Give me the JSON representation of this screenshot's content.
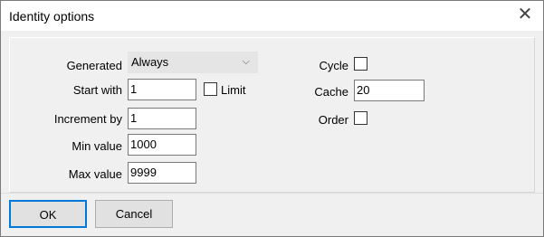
{
  "window": {
    "title": "Identity options"
  },
  "fields": {
    "generated": {
      "label": "Generated",
      "value": "Always"
    },
    "start_with": {
      "label": "Start with",
      "value": "1",
      "limit_label": "Limit"
    },
    "increment_by": {
      "label": "Increment by",
      "value": "1"
    },
    "min_value": {
      "label": "Min value",
      "value": "1000"
    },
    "max_value": {
      "label": "Max value",
      "value": "9999"
    },
    "cycle": {
      "label": "Cycle"
    },
    "cache": {
      "label": "Cache",
      "value": "20"
    },
    "order": {
      "label": "Order"
    }
  },
  "buttons": {
    "ok": "OK",
    "cancel": "Cancel"
  },
  "icons": {
    "close": "close-icon",
    "dropdown": "chevron-down-icon"
  }
}
